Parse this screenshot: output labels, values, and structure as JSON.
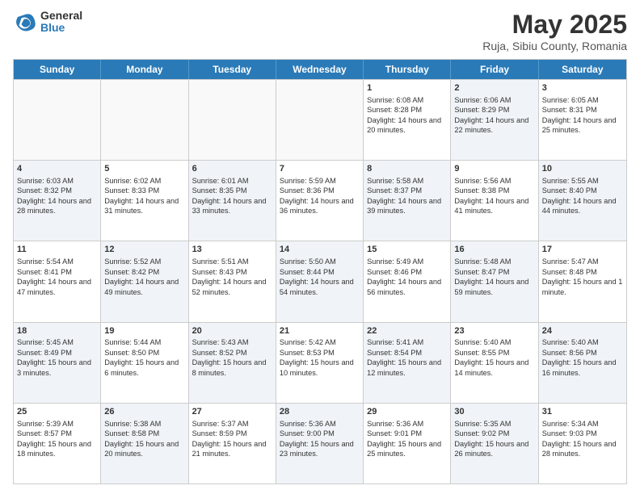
{
  "logo": {
    "general": "General",
    "blue": "Blue"
  },
  "title": {
    "month": "May 2025",
    "location": "Ruja, Sibiu County, Romania"
  },
  "header_days": [
    "Sunday",
    "Monday",
    "Tuesday",
    "Wednesday",
    "Thursday",
    "Friday",
    "Saturday"
  ],
  "weeks": [
    [
      {
        "day": "",
        "info": "",
        "shaded": false,
        "empty": true
      },
      {
        "day": "",
        "info": "",
        "shaded": false,
        "empty": true
      },
      {
        "day": "",
        "info": "",
        "shaded": false,
        "empty": true
      },
      {
        "day": "",
        "info": "",
        "shaded": false,
        "empty": true
      },
      {
        "day": "1",
        "info": "Sunrise: 6:08 AM\nSunset: 8:28 PM\nDaylight: 14 hours and 20 minutes.",
        "shaded": false,
        "empty": false
      },
      {
        "day": "2",
        "info": "Sunrise: 6:06 AM\nSunset: 8:29 PM\nDaylight: 14 hours and 22 minutes.",
        "shaded": true,
        "empty": false
      },
      {
        "day": "3",
        "info": "Sunrise: 6:05 AM\nSunset: 8:31 PM\nDaylight: 14 hours and 25 minutes.",
        "shaded": false,
        "empty": false
      }
    ],
    [
      {
        "day": "4",
        "info": "Sunrise: 6:03 AM\nSunset: 8:32 PM\nDaylight: 14 hours and 28 minutes.",
        "shaded": true,
        "empty": false
      },
      {
        "day": "5",
        "info": "Sunrise: 6:02 AM\nSunset: 8:33 PM\nDaylight: 14 hours and 31 minutes.",
        "shaded": false,
        "empty": false
      },
      {
        "day": "6",
        "info": "Sunrise: 6:01 AM\nSunset: 8:35 PM\nDaylight: 14 hours and 33 minutes.",
        "shaded": true,
        "empty": false
      },
      {
        "day": "7",
        "info": "Sunrise: 5:59 AM\nSunset: 8:36 PM\nDaylight: 14 hours and 36 minutes.",
        "shaded": false,
        "empty": false
      },
      {
        "day": "8",
        "info": "Sunrise: 5:58 AM\nSunset: 8:37 PM\nDaylight: 14 hours and 39 minutes.",
        "shaded": true,
        "empty": false
      },
      {
        "day": "9",
        "info": "Sunrise: 5:56 AM\nSunset: 8:38 PM\nDaylight: 14 hours and 41 minutes.",
        "shaded": false,
        "empty": false
      },
      {
        "day": "10",
        "info": "Sunrise: 5:55 AM\nSunset: 8:40 PM\nDaylight: 14 hours and 44 minutes.",
        "shaded": true,
        "empty": false
      }
    ],
    [
      {
        "day": "11",
        "info": "Sunrise: 5:54 AM\nSunset: 8:41 PM\nDaylight: 14 hours and 47 minutes.",
        "shaded": false,
        "empty": false
      },
      {
        "day": "12",
        "info": "Sunrise: 5:52 AM\nSunset: 8:42 PM\nDaylight: 14 hours and 49 minutes.",
        "shaded": true,
        "empty": false
      },
      {
        "day": "13",
        "info": "Sunrise: 5:51 AM\nSunset: 8:43 PM\nDaylight: 14 hours and 52 minutes.",
        "shaded": false,
        "empty": false
      },
      {
        "day": "14",
        "info": "Sunrise: 5:50 AM\nSunset: 8:44 PM\nDaylight: 14 hours and 54 minutes.",
        "shaded": true,
        "empty": false
      },
      {
        "day": "15",
        "info": "Sunrise: 5:49 AM\nSunset: 8:46 PM\nDaylight: 14 hours and 56 minutes.",
        "shaded": false,
        "empty": false
      },
      {
        "day": "16",
        "info": "Sunrise: 5:48 AM\nSunset: 8:47 PM\nDaylight: 14 hours and 59 minutes.",
        "shaded": true,
        "empty": false
      },
      {
        "day": "17",
        "info": "Sunrise: 5:47 AM\nSunset: 8:48 PM\nDaylight: 15 hours and 1 minute.",
        "shaded": false,
        "empty": false
      }
    ],
    [
      {
        "day": "18",
        "info": "Sunrise: 5:45 AM\nSunset: 8:49 PM\nDaylight: 15 hours and 3 minutes.",
        "shaded": true,
        "empty": false
      },
      {
        "day": "19",
        "info": "Sunrise: 5:44 AM\nSunset: 8:50 PM\nDaylight: 15 hours and 6 minutes.",
        "shaded": false,
        "empty": false
      },
      {
        "day": "20",
        "info": "Sunrise: 5:43 AM\nSunset: 8:52 PM\nDaylight: 15 hours and 8 minutes.",
        "shaded": true,
        "empty": false
      },
      {
        "day": "21",
        "info": "Sunrise: 5:42 AM\nSunset: 8:53 PM\nDaylight: 15 hours and 10 minutes.",
        "shaded": false,
        "empty": false
      },
      {
        "day": "22",
        "info": "Sunrise: 5:41 AM\nSunset: 8:54 PM\nDaylight: 15 hours and 12 minutes.",
        "shaded": true,
        "empty": false
      },
      {
        "day": "23",
        "info": "Sunrise: 5:40 AM\nSunset: 8:55 PM\nDaylight: 15 hours and 14 minutes.",
        "shaded": false,
        "empty": false
      },
      {
        "day": "24",
        "info": "Sunrise: 5:40 AM\nSunset: 8:56 PM\nDaylight: 15 hours and 16 minutes.",
        "shaded": true,
        "empty": false
      }
    ],
    [
      {
        "day": "25",
        "info": "Sunrise: 5:39 AM\nSunset: 8:57 PM\nDaylight: 15 hours and 18 minutes.",
        "shaded": false,
        "empty": false
      },
      {
        "day": "26",
        "info": "Sunrise: 5:38 AM\nSunset: 8:58 PM\nDaylight: 15 hours and 20 minutes.",
        "shaded": true,
        "empty": false
      },
      {
        "day": "27",
        "info": "Sunrise: 5:37 AM\nSunset: 8:59 PM\nDaylight: 15 hours and 21 minutes.",
        "shaded": false,
        "empty": false
      },
      {
        "day": "28",
        "info": "Sunrise: 5:36 AM\nSunset: 9:00 PM\nDaylight: 15 hours and 23 minutes.",
        "shaded": true,
        "empty": false
      },
      {
        "day": "29",
        "info": "Sunrise: 5:36 AM\nSunset: 9:01 PM\nDaylight: 15 hours and 25 minutes.",
        "shaded": false,
        "empty": false
      },
      {
        "day": "30",
        "info": "Sunrise: 5:35 AM\nSunset: 9:02 PM\nDaylight: 15 hours and 26 minutes.",
        "shaded": true,
        "empty": false
      },
      {
        "day": "31",
        "info": "Sunrise: 5:34 AM\nSunset: 9:03 PM\nDaylight: 15 hours and 28 minutes.",
        "shaded": false,
        "empty": false
      }
    ]
  ]
}
